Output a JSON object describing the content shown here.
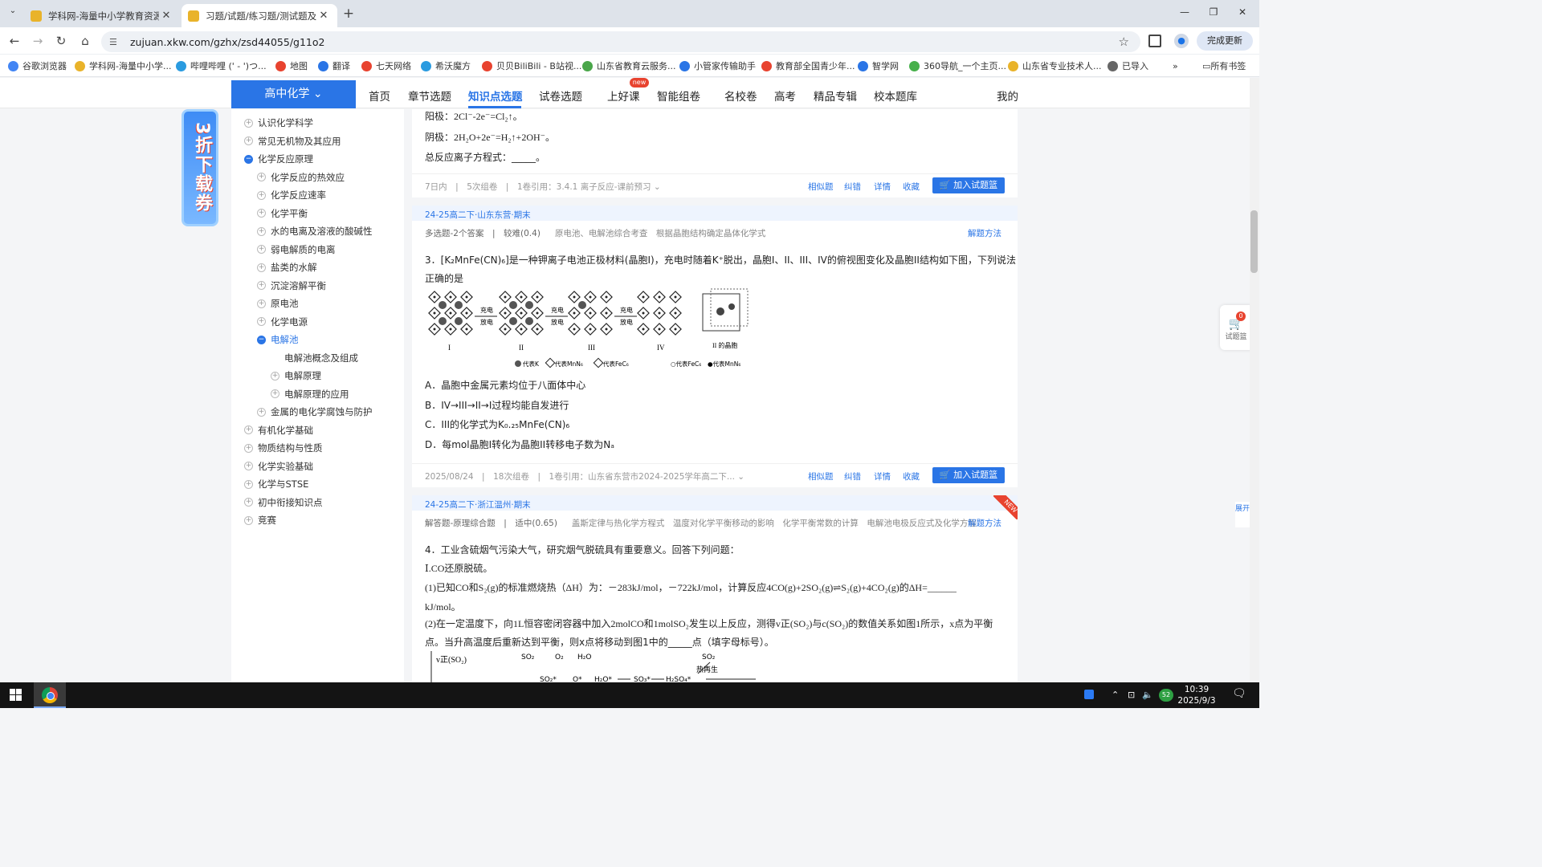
{
  "browser": {
    "tabs": [
      {
        "title": "学科网-海量中小学教育资源共享",
        "active": false
      },
      {
        "title": "习题/试题/练习题/测试题及答案",
        "active": true
      }
    ],
    "url": "zujuan.xkw.com/gzhx/zsd44055/g11o2",
    "update_label": "完成更新",
    "bookmarks": [
      "谷歌浏览器",
      "学科网-海量中小学...",
      "哔哩哔哩 (' - ')つ...",
      "地图",
      "翻译",
      "七天网络",
      "希沃魔方",
      "贝贝BiliBili - B站视...",
      "山东省教育云服务...",
      "小管家传输助手",
      "教育部全国青少年...",
      "智学网",
      "360导航_一个主页...",
      "山东省专业技术人...",
      "已导入"
    ],
    "bookmarks_more": "»",
    "all_bookmarks": "所有书签"
  },
  "site": {
    "subject": "高中化学",
    "nav": [
      "首页",
      "章节选题",
      "知识点选题",
      "试卷选题",
      "上好课",
      "智能组卷",
      "名校卷",
      "高考",
      "精品专辑",
      "校本题库"
    ],
    "nav_active": "知识点选题",
    "new_badge": "new",
    "mine": "我的"
  },
  "promo": {
    "text": "3折下载券"
  },
  "tree": [
    {
      "label": "认识化学科学",
      "level": 0,
      "state": "plus"
    },
    {
      "label": "常见无机物及其应用",
      "level": 0,
      "state": "plus"
    },
    {
      "label": "化学反应原理",
      "level": 0,
      "state": "minus"
    },
    {
      "label": "化学反应的热效应",
      "level": 1,
      "state": "plus"
    },
    {
      "label": "化学反应速率",
      "level": 1,
      "state": "plus"
    },
    {
      "label": "化学平衡",
      "level": 1,
      "state": "plus"
    },
    {
      "label": "水的电离及溶液的酸碱性",
      "level": 1,
      "state": "plus"
    },
    {
      "label": "弱电解质的电离",
      "level": 1,
      "state": "plus"
    },
    {
      "label": "盐类的水解",
      "level": 1,
      "state": "plus"
    },
    {
      "label": "沉淀溶解平衡",
      "level": 1,
      "state": "plus"
    },
    {
      "label": "原电池",
      "level": 1,
      "state": "plus"
    },
    {
      "label": "化学电源",
      "level": 1,
      "state": "plus"
    },
    {
      "label": "电解池",
      "level": 1,
      "state": "minus",
      "active": true
    },
    {
      "label": "电解池概念及组成",
      "level": 2,
      "state": "none"
    },
    {
      "label": "电解原理",
      "level": 2,
      "state": "plus"
    },
    {
      "label": "电解原理的应用",
      "level": 2,
      "state": "plus"
    },
    {
      "label": "金属的电化学腐蚀与防护",
      "level": 1,
      "state": "plus"
    },
    {
      "label": "有机化学基础",
      "level": 0,
      "state": "plus"
    },
    {
      "label": "物质结构与性质",
      "level": 0,
      "state": "plus"
    },
    {
      "label": "化学实验基础",
      "level": 0,
      "state": "plus"
    },
    {
      "label": "化学与STSE",
      "level": 0,
      "state": "plus"
    },
    {
      "label": "初中衔接知识点",
      "level": 0,
      "state": "plus"
    },
    {
      "label": "竞赛",
      "level": 0,
      "state": "plus"
    }
  ],
  "q2": {
    "lines": [
      "阳极：2Cl⁻-2e⁻=Cl₂↑。",
      "阴极：2H₂O+2e⁻=H₂↑+2OH⁻。",
      "总反应离子方程式：_____。"
    ],
    "date": "7日内",
    "assemble": "5次组卷",
    "cite": "1卷引用：3.4.1 离子反应-课前预习"
  },
  "q3": {
    "source": "24-25高二下·山东东营·期末",
    "type": "多选题-2个答案",
    "difficulty": "较难(0.4)",
    "tags": "原电池、电解池综合考查　根据晶胞结构确定晶体化学式",
    "stem1": "3．[K₂MnFe(CN)₆]是一种钾离子电池正极材料(晶胞I)，充电时随着K⁺脱出，晶胞I、II、III、IV的俯视图变化及晶胞II结构如下图，下列说法",
    "stem2": "正确的是",
    "figure_labels": [
      "I",
      "II",
      "III",
      "IV",
      "II 的晶胞"
    ],
    "arrow_top": "充电",
    "arrow_bottom": "放电",
    "legend": [
      "代表K",
      "代表MnN₆",
      "代表FeC₆",
      "○代表FeC₆",
      "●代表MnN₆"
    ],
    "options": [
      "A．晶胞中金属元素均位于八面体中心",
      "B．IV→III→II→I过程均能自发进行",
      "C．III的化学式为K₀.₂₅MnFe(CN)₆",
      "D．每mol晶胞I转化为晶胞II转移电子数为Nₐ"
    ],
    "date": "2025/08/24",
    "assemble": "18次组卷",
    "cite": "1卷引用：山东省东营市2024-2025学年高二下..."
  },
  "q4": {
    "source": "24-25高二下·浙江温州·期末",
    "type": "解答题-原理综合题",
    "difficulty": "适中(0.65)",
    "tags": "盖斯定律与热化学方程式　温度对化学平衡移动的影响　化学平衡常数的计算　电解池电极反应式及化学方程",
    "stem": "4．工业含硫烟气污染大气，研究烟气脱硫具有重要意义。回答下列问题：",
    "l1": "Ⅰ.CO还原脱硫。",
    "l2": "(1)已知CO和S₂(g)的标准燃烧热（ΔH）为：－283kJ/mol，－722kJ/mol，计算反应4CO(g)+2SO₂(g)⇌S₂(g)+4CO₂(g)的ΔH=______",
    "l3": "kJ/mol。",
    "l4": "(2)在一定温度下，向1L恒容密闭容器中加入2molCO和1molSO₂发生以上反应，测得v正(SO₂)与c(SO₂)的数值关系如图1所示，x点为平衡",
    "l5": "点。当升高温度后重新达到平衡，则x点将移动到图1中的_____点（填字母标号）。",
    "fig_labels": [
      "v正(SO₂)",
      "SO₂",
      "O₂",
      "H₂O",
      "SO₂",
      "热再生",
      "SO₂*",
      "O*",
      "H₂O*",
      "SO₃*",
      "H₂SO₄*"
    ],
    "new_tag": "NEW"
  },
  "actions": {
    "similar": "相似题",
    "correct": "纠错",
    "detail": "详情",
    "favorite": "收藏",
    "add": "加入试题篮",
    "method": "解题方法"
  },
  "cart": {
    "count": "0",
    "label": "试题篮"
  },
  "expand": "展开",
  "taskbar": {
    "time": "10:39",
    "date": "2025/9/3",
    "badge": "52"
  }
}
